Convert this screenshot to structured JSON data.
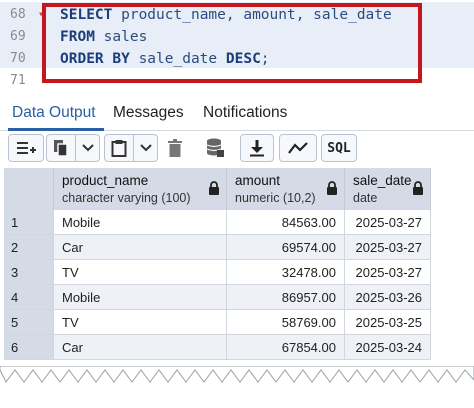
{
  "editor": {
    "lines": [
      {
        "num": "68",
        "parts": [
          {
            "t": "SELECT",
            "k": true
          },
          {
            "t": " product_name, amount, sale_date",
            "k": false
          }
        ]
      },
      {
        "num": "69",
        "parts": [
          {
            "t": "FROM",
            "k": true
          },
          {
            "t": " sales",
            "k": false
          }
        ]
      },
      {
        "num": "70",
        "parts": [
          {
            "t": "ORDER BY",
            "k": true
          },
          {
            "t": " sale_date ",
            "k": false
          },
          {
            "t": "DESC",
            "k": true
          },
          {
            "t": ";",
            "k": false
          }
        ]
      },
      {
        "num": "71",
        "parts": []
      }
    ]
  },
  "tabs": [
    "Data Output",
    "Messages",
    "Notifications"
  ],
  "active_tab": "Data Output",
  "toolbar": {
    "buttons": [
      "add-row",
      "copy",
      "copy-dropdown",
      "paste",
      "paste-dropdown",
      "delete",
      "save-data",
      "download",
      "graph",
      "sql"
    ],
    "sql_label": "SQL"
  },
  "grid": {
    "columns": [
      {
        "name": "product_name",
        "type": "character varying (100)",
        "align": "left"
      },
      {
        "name": "amount",
        "type": "numeric (10,2)",
        "align": "right"
      },
      {
        "name": "sale_date",
        "type": "date",
        "align": "right"
      }
    ],
    "rows": [
      {
        "n": "1",
        "cells": [
          "Mobile",
          "84563.00",
          "2025-03-27"
        ]
      },
      {
        "n": "2",
        "cells": [
          "Car",
          "69574.00",
          "2025-03-27"
        ]
      },
      {
        "n": "3",
        "cells": [
          "TV",
          "32478.00",
          "2025-03-27"
        ]
      },
      {
        "n": "4",
        "cells": [
          "Mobile",
          "86957.00",
          "2025-03-26"
        ]
      },
      {
        "n": "5",
        "cells": [
          "TV",
          "58769.00",
          "2025-03-25"
        ]
      },
      {
        "n": "6",
        "cells": [
          "Car",
          "67854.00",
          "2025-03-24"
        ]
      }
    ]
  },
  "colors": {
    "highlight_box": "#c4161c",
    "active_tab": "#2a5fa3",
    "header_bg": "#d5dbe6"
  }
}
